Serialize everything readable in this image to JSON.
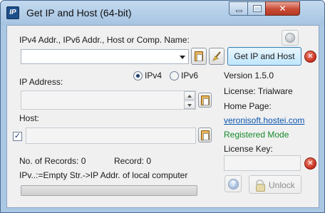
{
  "window": {
    "title": "Get IP and Host (64-bit)",
    "app_icon_text": "IP",
    "buttons": {
      "close_glyph": "✕"
    }
  },
  "query": {
    "label": "IPv4 Addr., IPv6 Addr., Host or Comp. Name:",
    "value": "",
    "get_button_label": "Get IP and Host"
  },
  "ip_address": {
    "label": "IP Address:",
    "ipv4_label": "IPv4",
    "ipv6_label": "IPv6",
    "selected": "IPv4",
    "value": ""
  },
  "host": {
    "label": "Host:",
    "checked": true,
    "check_glyph": "✓",
    "value": ""
  },
  "stats": {
    "records_text": "No. of Records: 0",
    "record_text": "Record: 0",
    "hint": "IPv..:=Empty Str.->IP Addr. of local computer",
    "progress": 0
  },
  "info": {
    "version": "Version 1.5.0",
    "license": "License: Trialware",
    "homepage_label": "Home Page:",
    "homepage_link": "veronisoft.hostei.com",
    "registered": "Registered Mode",
    "license_key_label": "License Key:",
    "license_key_value": "",
    "unlock_label": "Unlock",
    "help_glyph": "?"
  },
  "colors": {
    "link": "#0a55b0",
    "registered": "#138a2a",
    "close_red": "#c84a34",
    "primary_button": "#bee6fd"
  },
  "icons": {
    "app": "ip-app-icon",
    "dropdown": "chevron-down-icon",
    "paste": "clipboard-icon",
    "clear": "broom-icon",
    "cancel": "red-x-icon",
    "globe": "globe-icon",
    "help": "help-icon",
    "lock": "lock-icon"
  }
}
